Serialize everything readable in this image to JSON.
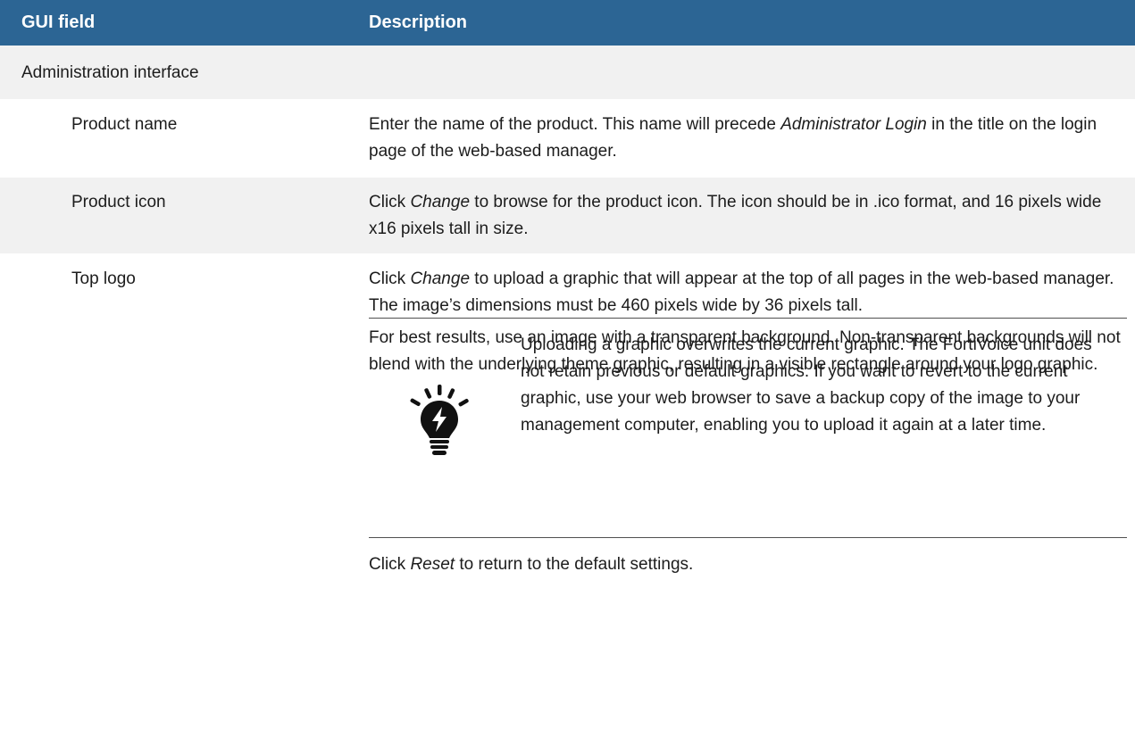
{
  "header": {
    "col_field": "GUI field",
    "col_description": "Description"
  },
  "section": {
    "title": "Administration interface"
  },
  "rows": [
    {
      "field": "Product name",
      "desc_before": "Enter the name of the product. This name will precede ",
      "desc_italic": "Administrator Login",
      "desc_after": " in the title on the login page of the web-based manager."
    },
    {
      "field": "Product icon",
      "desc_before": "Click ",
      "desc_italic": "Change",
      "desc_after": " to browse for the product icon. The icon should be in .ico format, and 16 pixels wide x16 pixels tall in size."
    },
    {
      "field": "Top logo",
      "desc_before": "Click ",
      "desc_italic": "Change",
      "desc_after": " to upload a graphic that will appear at the top of all pages in the web-based manager. The image’s dimensions must be 460 pixels wide by 36 pixels tall.",
      "desc_para2": "For best results, use an image with a transparent background. Non-transparent backgrounds will not blend with the underlying theme graphic, resulting in a visible rectangle around your logo graphic.",
      "note": "Uploading a graphic overwrites the current graphic. The FortiVoice unit does not retain previous or default graphics. If you want to revert to the current graphic, use your web browser to save a backup copy of the image to your management computer, enabling you to upload it again at a later time.",
      "note_icon": "lightbulb-tip-icon",
      "reset_before": "Click ",
      "reset_italic": "Reset",
      "reset_after": " to return to the default settings."
    }
  ],
  "colors": {
    "header_bg": "#2c6594",
    "alt_row_bg": "#f1f1f1",
    "text": "#1c1c1c"
  }
}
